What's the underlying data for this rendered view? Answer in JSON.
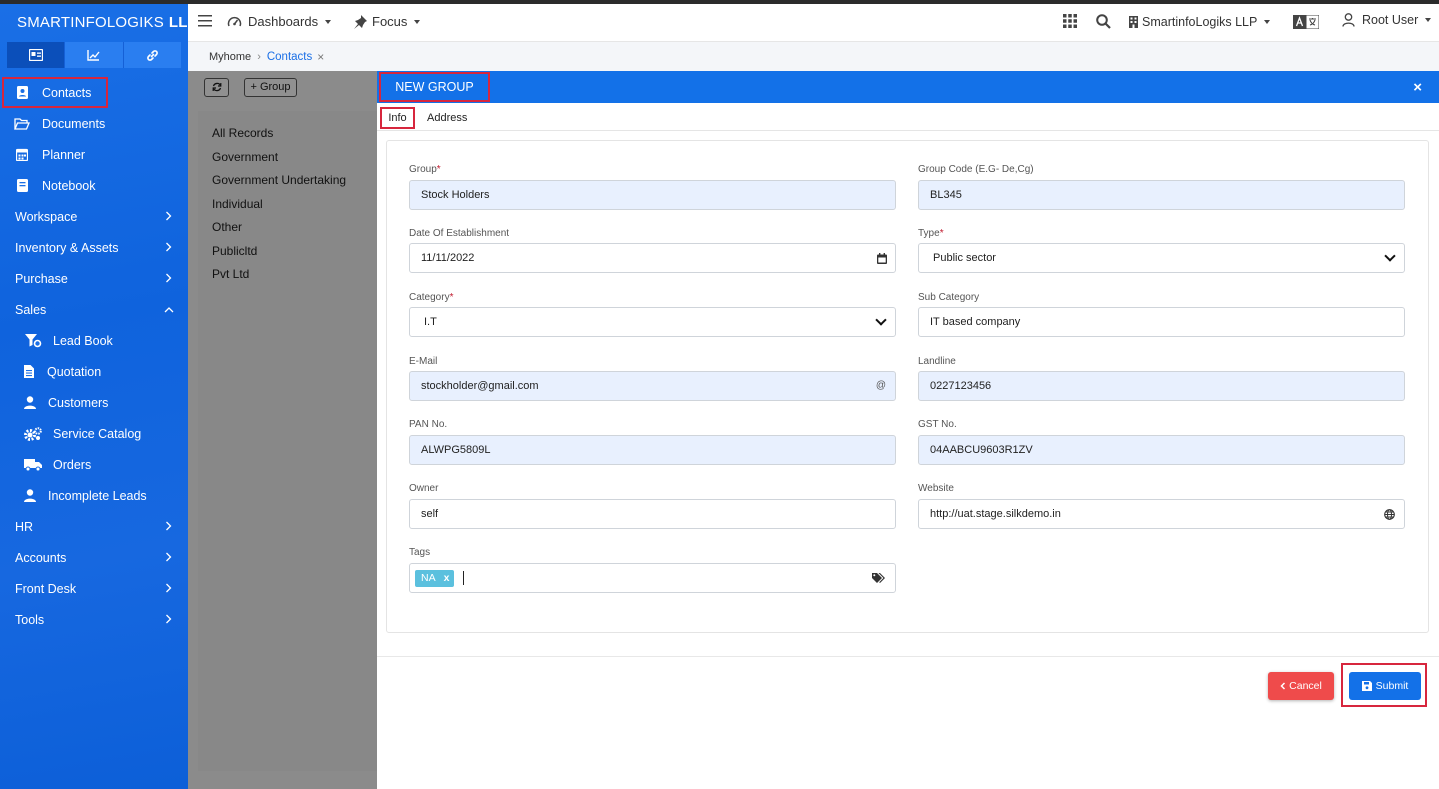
{
  "brand": {
    "name_light": "SMARTINFOLOGIKS",
    "name_bold": "LLP"
  },
  "sidebar": {
    "tabs": [
      {
        "icon": "id-card-icon"
      },
      {
        "icon": "chart-line-icon"
      },
      {
        "icon": "link-icon"
      }
    ],
    "items": [
      {
        "label": "Contacts",
        "icon": "contact-card-icon"
      },
      {
        "label": "Documents",
        "icon": "folder-open-icon"
      },
      {
        "label": "Planner",
        "icon": "calendar-icon"
      },
      {
        "label": "Notebook",
        "icon": "notebook-icon"
      },
      {
        "label": "Workspace"
      },
      {
        "label": "Inventory & Assets"
      },
      {
        "label": "Purchase"
      },
      {
        "label": "Sales"
      },
      {
        "label": "Lead Book",
        "icon": "funnel-icon"
      },
      {
        "label": "Quotation",
        "icon": "file-icon"
      },
      {
        "label": "Customers",
        "icon": "user-icon"
      },
      {
        "label": "Service Catalog",
        "icon": "gears-icon"
      },
      {
        "label": "Orders",
        "icon": "truck-icon"
      },
      {
        "label": "Incomplete Leads",
        "icon": "user-icon"
      },
      {
        "label": "HR"
      },
      {
        "label": "Accounts"
      },
      {
        "label": "Front Desk"
      },
      {
        "label": "Tools"
      }
    ]
  },
  "topbar": {
    "dashboards": "Dashboards",
    "focus": "Focus",
    "company": "SmartinfoLogiks LLP",
    "user": "Root User"
  },
  "breadcrumb": {
    "home": "Myhome",
    "current": "Contacts",
    "close": "×"
  },
  "groups_panel": {
    "add_group": "+ Group",
    "items": [
      "All Records",
      "Government",
      "Government Undertaking",
      "Individual",
      "Other",
      "Publicltd",
      "Pvt Ltd"
    ]
  },
  "modal": {
    "title": "NEW GROUP",
    "close": "×",
    "tabs": [
      "Info",
      "Address"
    ],
    "fields": {
      "group": {
        "label": "Group",
        "value": "Stock Holders"
      },
      "group_code": {
        "label": "Group Code (E.G- De,Cg)",
        "value": "BL345"
      },
      "date": {
        "label": "Date Of Establishment",
        "value": "11/11/2022"
      },
      "type": {
        "label": "Type",
        "value": "Public sector"
      },
      "category": {
        "label": "Category",
        "value": "I.T"
      },
      "sub_category": {
        "label": "Sub Category",
        "value": "IT based company"
      },
      "email": {
        "label": "E-Mail",
        "value": "stockholder@gmail.com",
        "suffix": "@"
      },
      "landline": {
        "label": "Landline",
        "value": "0227123456"
      },
      "pan": {
        "label": "PAN No.",
        "value": "ALWPG5809L"
      },
      "gst": {
        "label": "GST No.",
        "value": "04AABCU9603R1ZV"
      },
      "owner": {
        "label": "Owner",
        "value": "self"
      },
      "website": {
        "label": "Website",
        "value": "http://uat.stage.silkdemo.in"
      },
      "tags": {
        "label": "Tags",
        "tag": "NA",
        "remove": "x"
      }
    },
    "required_mark": "*",
    "cancel": "Cancel",
    "submit": "Submit"
  },
  "colors": {
    "primary": "#1371e8",
    "danger": "#ef4b4b",
    "highlight": "#d7263d",
    "tag": "#5bc0de"
  }
}
